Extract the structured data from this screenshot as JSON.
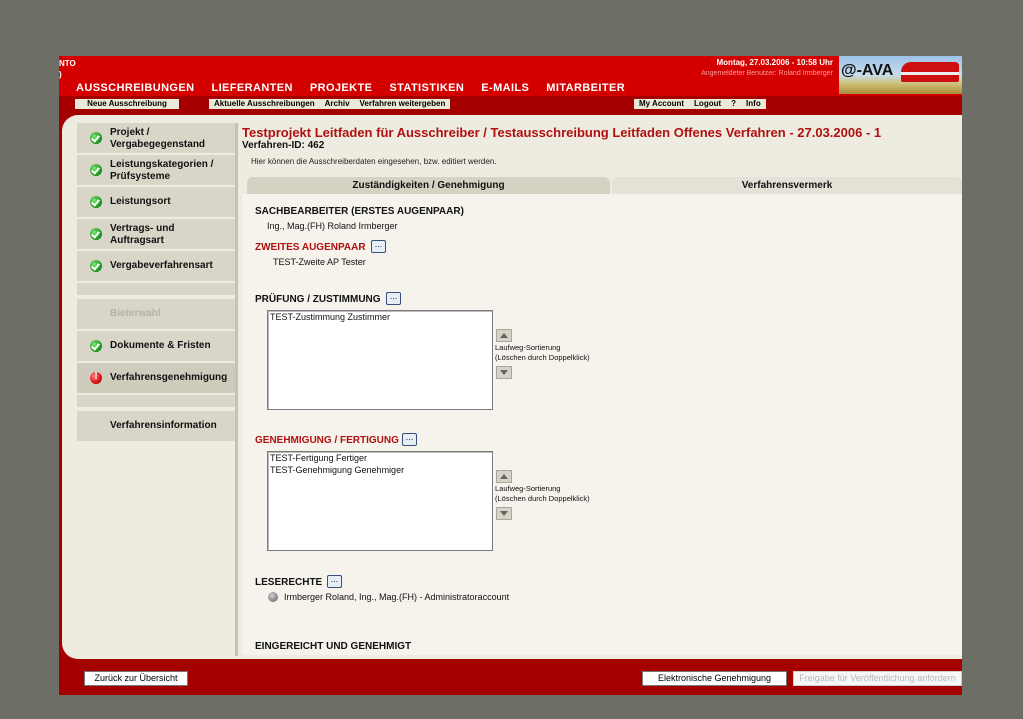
{
  "header": {
    "left_fragment_1": "NTO",
    "left_fragment_2": ")",
    "datetime": "Montag, 27.03.2006 - 10:58 Uhr",
    "user_info": "Angemeldeter Benutzer: Roland Irmberger",
    "logo_text": "@-AVA"
  },
  "main_nav": [
    "AUSSCHREIBUNGEN",
    "LIEFERANTEN",
    "PROJEKTE",
    "STATISTIKEN",
    "E-MAILS",
    "MITARBEITER"
  ],
  "sub_nav": {
    "new_tender": "Neue Ausschreibung",
    "current_tenders": "Aktuelle Ausschreibungen",
    "archive": "Archiv",
    "forward_procedure": "Verfahren weitergeben",
    "my_account": "My Account",
    "logout": "Logout",
    "help": "?",
    "info": "Info"
  },
  "sidebar": {
    "items": [
      {
        "label": "Projekt /\nVergabegegenstand",
        "status": "ok"
      },
      {
        "label": "Leistungskategorien /\nPrüfsysteme",
        "status": "ok"
      },
      {
        "label": "Leistungsort",
        "status": "ok"
      },
      {
        "label": "Vertrags- und\nAuftragsart",
        "status": "ok"
      },
      {
        "label": "Vergabeverfahrensart",
        "status": "ok"
      },
      {
        "label": "Bieterwahl",
        "status": "disabled"
      },
      {
        "label": "Dokumente & Fristen",
        "status": "ok"
      },
      {
        "label": "Verfahrensgenehmigung",
        "status": "error"
      },
      {
        "label": "Verfahrensinformation",
        "status": "none"
      }
    ]
  },
  "content": {
    "title": "Testprojekt Leitfaden für Ausschreiber / Testausschreibung Leitfaden Offenes Verfahren - 27.03.2006 - 1",
    "procedure_id": "Verfahren-ID: 462",
    "description": "Hier können die Ausschreiberdaten eingesehen, bzw. editiert werden.",
    "tabs": [
      "Zuständigkeiten / Genehmigung",
      "Verfahrensvermerk"
    ],
    "sections": {
      "sachbearbeiter_title": "SACHBEARBEITER (ERSTES AUGENPAAR)",
      "sachbearbeiter_value": "Ing., Mag.(FH) Roland Irmberger",
      "zweites_title": "ZWEITES AUGENPAAR",
      "zweites_value": "TEST-Zweite AP Tester",
      "pruefung_title": "PRÜFUNG / ZUSTIMMUNG",
      "pruefung_items": [
        "TEST-Zustimmung Zustimmer"
      ],
      "genehmigung_title": "GENEHMIGUNG / FERTIGUNG",
      "genehmigung_items": [
        "TEST-Fertigung Fertiger",
        "TEST-Genehmigung Genehmiger"
      ],
      "sort_hint_1": "Laufweg-Sortierung",
      "sort_hint_2": "(Löschen durch Doppelklick)",
      "leserechte_title": "LESERECHTE",
      "leserechte_value": "Irmberger Roland, Ing., Mag.(FH) - Administratoraccount",
      "eingereicht_title": "EINGEREICHT UND GENEHMIGT",
      "dots": "..."
    }
  },
  "footer": {
    "back": "Zurück zur Übersicht",
    "electronic_approval": "Elektronische Genehmigung",
    "release_request": "Freigabe für Veröffentlichung anfordern"
  }
}
